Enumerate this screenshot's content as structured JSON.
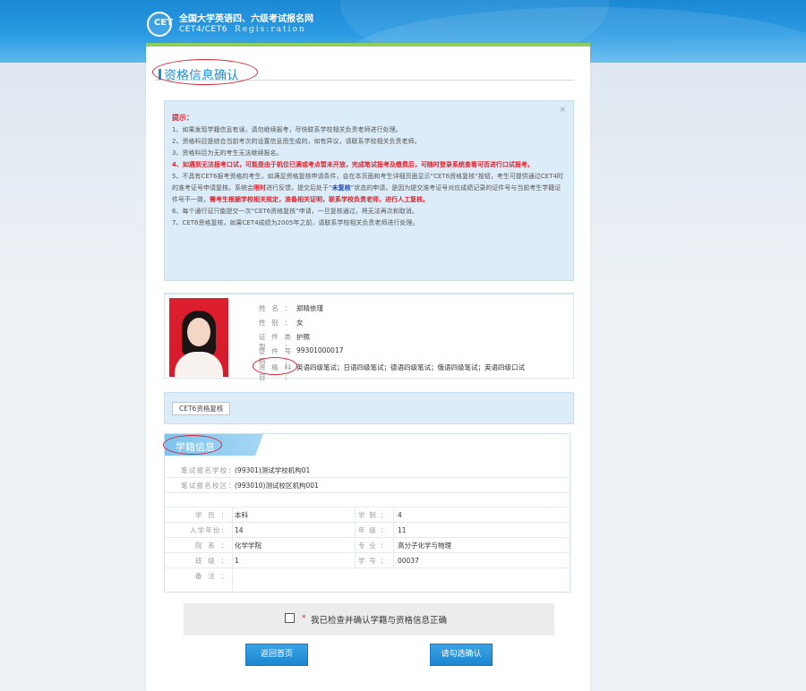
{
  "header": {
    "title": "全国大学英语四、六级考试报名网",
    "subtitle": "CET4/CET6",
    "subtitle_en": "Regis:ration",
    "logo_text": "CET"
  },
  "page": {
    "section_title": "资格信息确认",
    "colors": {
      "accent": "#1e8fd6",
      "alert": "#e2202a",
      "link_blue": "#1a3fbf",
      "green_bar": "#8ccf5a"
    }
  },
  "tips": {
    "close_icon": "×",
    "heading": "提示：",
    "l1": "1、如果发现学籍信息有误，请勿继续报考，尽快联系学校相关负责老师进行处理。",
    "l2": "2、资格科目是综合当前考次的设置信息而生成的，如有异议，请联系学校相关负责老师。",
    "l3": "3、资格科目为无的考生无法继续报名。",
    "l4": "4、如遇到无法报考口试，可能是由于机位已满或考点暂未开放，完成笔试报考及缴费后，可随时登录系统查看可否进行口试报考。",
    "l5a": "5、不具有CET6报考资格的考生，如满足资格复核申请条件，会在本页面和考生详细页面显示“CET6资格复核”按钮，考生可提供通过CET4时的准考证号申请复核。系统会",
    "l5b": "限时",
    "l5c": "进行反馈，提交后处于“",
    "l5d": "未复核",
    "l5e": "”状态的申请，是因为提交准考证号对应成绩记录的证件号与当前考生学籍证件号不一致，",
    "l5f": "需考生根据学校相关规定，准备相关证明，联系学校负责老师，进行人工复核。",
    "l6": "6、每个通行证只能提交一次“CET6资格复核”申请，一旦复核通过，将无法再次和取消。",
    "l7": "7、CET6资格复核，如果CET4成绩为2005年之前，请联系学校相关负责老师进行处理。"
  },
  "student": {
    "name_label": "姓名：",
    "name": "郑晴依瑾",
    "gender_label": "性别：",
    "gender": "女",
    "id_type_label": "证件类型：",
    "id_type": "护照",
    "id_no_label": "证件号码：",
    "id_no": "99301000017",
    "subjects_label": "资格科目：",
    "subjects": "英语四级笔试；日语四级笔试；德语四级笔试；俄语四级笔试；英语四级口试"
  },
  "cet6": {
    "button": "CET6资格复核"
  },
  "school_info": {
    "tab": "学籍信息",
    "school_label": "笔试报名学校：",
    "school": "(99301)测试学校机构01",
    "campus_label": "笔试报名校区：",
    "campus": "(993010)测试校区机构001",
    "edu_label": "学历：",
    "edu": "本科",
    "years_label": "学制：",
    "years": "4",
    "enroll_label": "入学年份：",
    "enroll": "14",
    "grade_label": "年级：",
    "grade": "11",
    "dept_label": "院系：",
    "dept": "化学学院",
    "major_label": "专业：",
    "major": "高分子化学与物理",
    "class_label": "班级：",
    "class": "1",
    "sno_label": "学号：",
    "sno": "00037",
    "remark_label": "备注：",
    "remark": ""
  },
  "confirm": {
    "star": "*",
    "text": "我已检查并确认学籍与资格信息正确"
  },
  "buttons": {
    "back": "返回首页",
    "check": "请勾选确认"
  }
}
